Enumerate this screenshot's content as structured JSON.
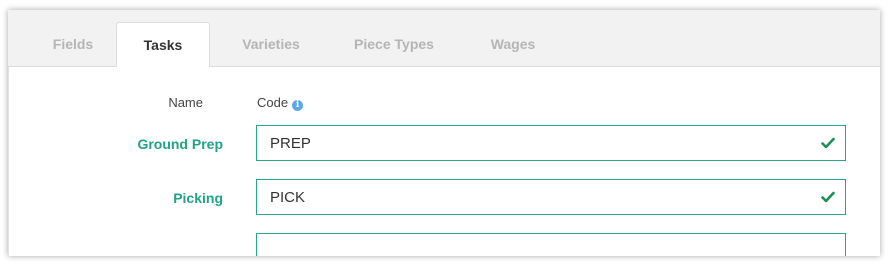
{
  "tabs": [
    {
      "label": "Fields",
      "active": false
    },
    {
      "label": "Tasks",
      "active": true
    },
    {
      "label": "Varieties",
      "active": false
    },
    {
      "label": "Piece Types",
      "active": false
    },
    {
      "label": "Wages",
      "active": false
    }
  ],
  "table": {
    "header_name": "Name",
    "header_code": "Code",
    "header_code_icon": "info-icon"
  },
  "rows": [
    {
      "name": "Ground Prep",
      "code": "PREP",
      "status_icon": "check-icon"
    },
    {
      "name": "Picking",
      "code": "PICK",
      "status_icon": "check-icon"
    }
  ],
  "colors": {
    "accent": "#20a387",
    "field_border": "#26a78a",
    "info": "#5aa9e6"
  }
}
